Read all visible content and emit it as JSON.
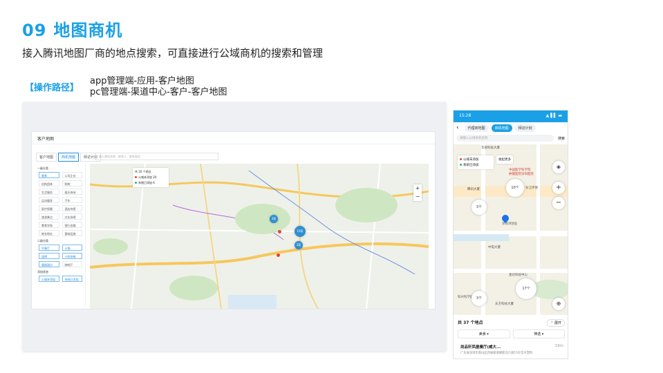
{
  "header": {
    "number": "09",
    "title": "地图商机",
    "subtitle": "接入腾讯地图厂商的地点搜索，可直接进行公域商机的搜索和管理"
  },
  "operation": {
    "label": "【操作路径】",
    "paths": [
      "app管理端-应用-客户地图",
      "pc管理端-渠道中心-客户-客户地图"
    ]
  },
  "desktop": {
    "window_title": "客户地图",
    "tabs": [
      {
        "label": "客户地图"
      },
      {
        "label": "商机地图"
      },
      {
        "label": "拜访计划"
      }
    ],
    "search_placeholder": "输入商机名称、联系人、联系电话",
    "sidebar": {
      "groups": [
        {
          "label": "一级分类",
          "items": [
            "美食",
            "公司企业",
            "机构团体",
            "购物",
            "生活服务",
            "娱乐休闲",
            "运动健身",
            "汽车",
            "医疗保健",
            "酒店宾馆",
            "旅游景点",
            "文化场馆",
            "教育学校",
            "银行金融",
            "地名地址",
            "基础设施"
          ]
        },
        {
          "label": "二级分类",
          "items": [
            "中餐厅",
            "火锅",
            "烧烤",
            "小吃快餐",
            "蛋糕甜点",
            "咖啡厅"
          ]
        },
        {
          "label": "添加状态",
          "items": [
            "公域未添加",
            "系统已添加"
          ]
        }
      ]
    },
    "legend": {
      "title": "共 20 个地点",
      "unadded": "公域未添加 20",
      "added": "系统已添加 6"
    },
    "zoom_in": "+",
    "zoom_out": "−",
    "clusters": [
      "3家",
      "15家",
      "3家"
    ],
    "colors": {
      "accent": "#1a8be0",
      "unadded": "#e8432b",
      "added": "#2bb56b"
    }
  },
  "mobile": {
    "status_time": "15:28",
    "status_icons": "▲ ▌▌ ▬",
    "back": "‹",
    "tabs": [
      {
        "label": "代理商地图"
      },
      {
        "label": "商机地图"
      },
      {
        "label": "拜访计划"
      }
    ],
    "search_placeholder": "请输入公域商机名称",
    "search_button": "搜索",
    "legend": {
      "unadded": "公域未添加",
      "added": "系统已添加"
    },
    "collapse": "收起更多",
    "clusters": [
      "10个",
      "3个",
      "17个",
      "3个"
    ],
    "map_labels": [
      "华丽科技大厦",
      "中国医学科学院",
      "肿瘤医院深圳医院",
      "腾讯大厦",
      "东江环保",
      "深圳湾创业",
      "中电大厦",
      "金达科技中心",
      "科兴科学园",
      "东方科技大厦"
    ],
    "summary": "共 37 个地点",
    "expand": "展开",
    "filters": [
      "美食",
      "筛选"
    ],
    "item": {
      "name": "尚品轩凤凰餐厅(威大...",
      "distance": "19m",
      "address": "广东省深圳市南山区西丽街道麻新北六道15号华大塑料"
    }
  }
}
